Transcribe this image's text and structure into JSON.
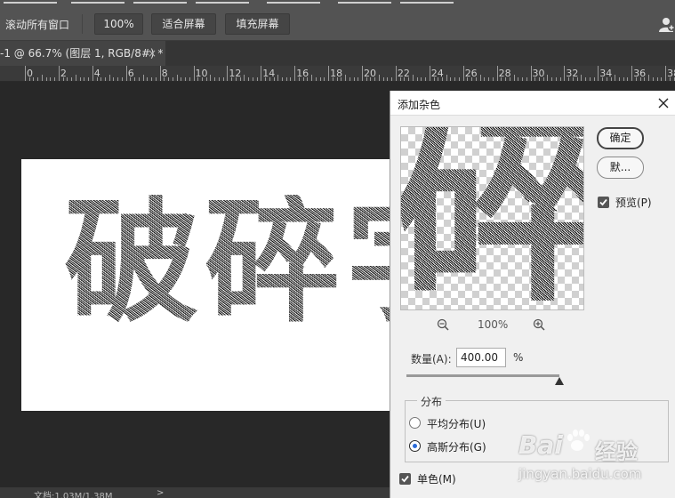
{
  "options_bar": {
    "label": "滚动所有窗口",
    "zoom_button": "100%",
    "fit_button": "适合屏幕",
    "fill_button": "填充屏幕"
  },
  "document_tab": {
    "title": "-1 @ 66.7% (图层 1, RGB/8#) *",
    "close": "×"
  },
  "ruler": {
    "labels": [
      "0",
      "2",
      "4",
      "6",
      "8",
      "10",
      "12",
      "14",
      "16",
      "18",
      "20",
      "22",
      "24",
      "26",
      "28",
      "30",
      "32",
      "34",
      "36",
      "38"
    ]
  },
  "canvas": {
    "text": "破碎字"
  },
  "status_bar": {
    "doc_info": "文档:1.03M/1.38M"
  },
  "dialog": {
    "title": "添加杂色",
    "ok_label": "确定",
    "default_label": "默...",
    "preview_label": "预览(P)",
    "preview_checked": true,
    "preview_text": "碎",
    "zoom_level": "100%",
    "amount_label": "数量(A):",
    "amount_value": "400.00",
    "amount_unit": "%",
    "amount_fraction": 1.0,
    "distribution_label": "分布",
    "uniform_label": "平均分布(U)",
    "gaussian_label": "高斯分布(G)",
    "selected_distribution": "gaussian",
    "mono_label": "单色(M)",
    "mono_checked": true
  },
  "watermark": {
    "brand": "Bai",
    "brand2": "经验",
    "url": "jingyan.baidu.com"
  },
  "icons": {
    "user": "user-icon",
    "close": "close-icon",
    "zoom_out": "zoom-out-icon",
    "zoom_in": "zoom-in-icon",
    "paw": "paw-icon"
  }
}
